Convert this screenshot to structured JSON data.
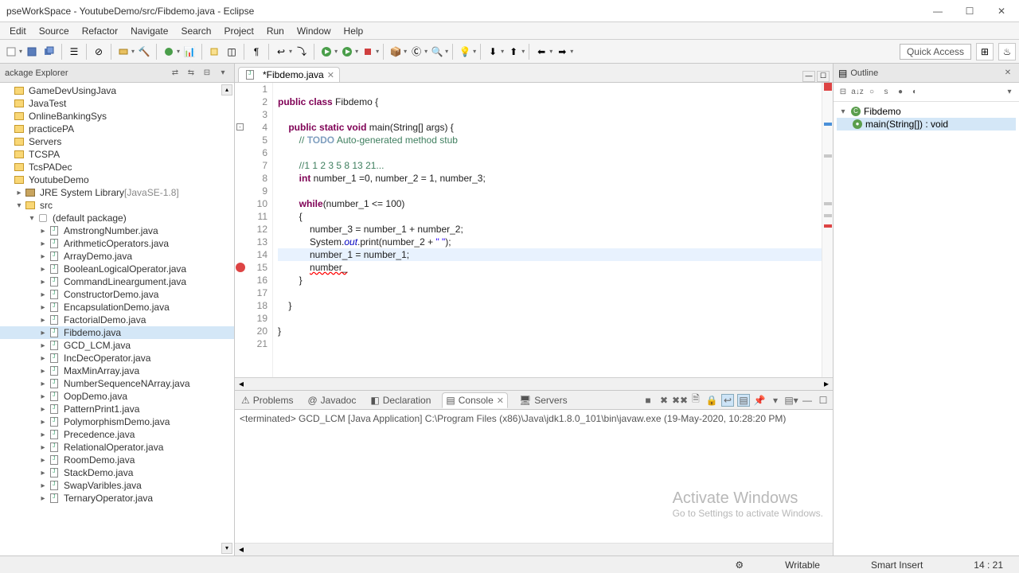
{
  "titlebar": {
    "title": "pseWorkSpace - YoutubeDemo/src/Fibdemo.java - Eclipse"
  },
  "menu": [
    "Edit",
    "Source",
    "Refactor",
    "Navigate",
    "Search",
    "Project",
    "Run",
    "Window",
    "Help"
  ],
  "quick_access": "Quick Access",
  "package_explorer": {
    "title": "ackage Explorer",
    "projects": [
      "GameDevUsingJava",
      "JavaTest",
      "OnlineBankingSys",
      "practicePA",
      "Servers",
      "TCSPA",
      "TcsPADec",
      "YoutubeDemo"
    ],
    "jre_label": "JRE System Library",
    "jre_decor": "[JavaSE-1.8]",
    "src_label": "src",
    "default_pkg": "(default package)",
    "files": [
      "AmstrongNumber.java",
      "ArithmeticOperators.java",
      "ArrayDemo.java",
      "BooleanLogicalOperator.java",
      "CommandLineargument.java",
      "ConstructorDemo.java",
      "EncapsulationDemo.java",
      "FactorialDemo.java",
      "Fibdemo.java",
      "GCD_LCM.java",
      "IncDecOperator.java",
      "MaxMinArray.java",
      "NumberSequenceNArray.java",
      "OopDemo.java",
      "PatternPrint1.java",
      "PolymorphismDemo.java",
      "Precedence.java",
      "RelationalOperator.java",
      "RoomDemo.java",
      "StackDemo.java",
      "SwapVaribles.java",
      "TernaryOperator.java"
    ],
    "selected_file": "Fibdemo.java"
  },
  "editor": {
    "tab_label": "*Fibdemo.java",
    "code_tokens": [
      [],
      [
        {
          "kw": "public"
        },
        " ",
        {
          "kw": "class"
        },
        " Fibdemo {"
      ],
      [],
      [
        "    ",
        {
          "kw": "public"
        },
        " ",
        {
          "kw": "static"
        },
        " ",
        {
          "kw": "void"
        },
        " main(String[] args) {"
      ],
      [
        "        ",
        {
          "cm": "// "
        },
        {
          "cm-task": "TODO"
        },
        {
          "cm": " Auto-generated method stub"
        }
      ],
      [],
      [
        "        ",
        {
          "cm": "//1 1 2 3 5 8 13 21..."
        }
      ],
      [
        "        ",
        {
          "kw": "int"
        },
        " number_1 =0, number_2 = 1, number_3;"
      ],
      [],
      [
        "        ",
        {
          "kw": "while"
        },
        "(number_1 <= 100)"
      ],
      [
        "        {"
      ],
      [
        "            number_3 = number_1 + number_2;"
      ],
      [
        "            System.",
        {
          "fld": "out"
        },
        ".print(number_2 + ",
        {
          "st": "\" \""
        },
        ");"
      ],
      [
        "            number_1 = number_1;"
      ],
      [
        "            ",
        {
          "err": "number_"
        }
      ],
      [
        "        }"
      ],
      [],
      [
        "    }"
      ],
      [],
      [
        "}"
      ],
      []
    ],
    "error_line": 15,
    "current_line": 14
  },
  "bottom": {
    "tabs": [
      "Problems",
      "Javadoc",
      "Declaration",
      "Console",
      "Servers"
    ],
    "active_tab": "Console",
    "console_header": "<terminated> GCD_LCM [Java Application] C:\\Program Files (x86)\\Java\\jdk1.8.0_101\\bin\\javaw.exe (19-May-2020, 10:28:20 PM)"
  },
  "outline": {
    "title": "Outline",
    "class_name": "Fibdemo",
    "method": "main(String[]) : void"
  },
  "statusbar": {
    "writable": "Writable",
    "insert": "Smart Insert",
    "pos": "14 : 21"
  },
  "watermark": {
    "line1": "Activate Windows",
    "line2": "Go to Settings to activate Windows."
  }
}
